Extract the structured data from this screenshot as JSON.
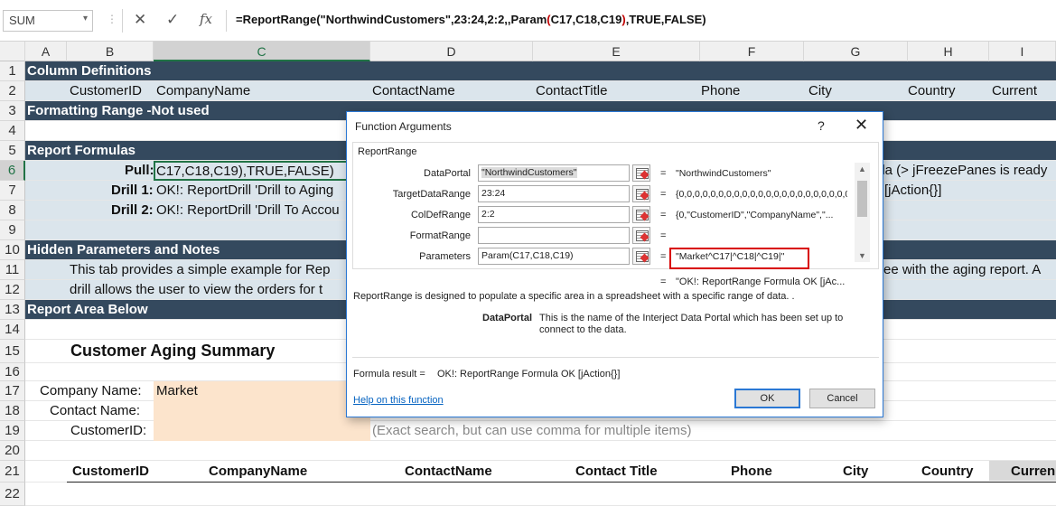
{
  "formula_bar": {
    "name_box": "SUM",
    "cancel_icon": "✕",
    "enter_icon": "✓",
    "fx_icon": "fx",
    "formula_a": "=ReportRange(\"NorthwindCustomers\",23:24,2:2,,Param",
    "formula_b": "(",
    "formula_c": "C17,C18,C19",
    "formula_d": ")",
    "formula_e": ",TRUE,FALSE)"
  },
  "columns": [
    "A",
    "B",
    "C",
    "D",
    "E",
    "F",
    "G",
    "H",
    "I"
  ],
  "rows": [
    "1",
    "2",
    "3",
    "4",
    "5",
    "6",
    "7",
    "8",
    "9",
    "10",
    "11",
    "12",
    "13",
    "14",
    "15",
    "16",
    "17",
    "18",
    "19",
    "20",
    "21",
    "22"
  ],
  "sheet": {
    "col_definitions": "Column Definitions",
    "col_defs": [
      "CustomerID",
      "CompanyName",
      "ContactName",
      "ContactTitle",
      "Phone",
      "City",
      "Country",
      "Current"
    ],
    "formatting_range": "Formatting Range -Not used",
    "report_formulas": "Report Formulas",
    "pull_label": "Pull:",
    "pull_value": "C17,C18,C19),TRUE,FALSE)",
    "drill1_label": "Drill 1:",
    "drill1_value": "OK!: ReportDrill 'Drill to Aging",
    "drill2_label": "Drill 2:",
    "drill2_value": "OK!: ReportDrill 'Drill To Accou",
    "right_row6": "ula (> jFreezePanes is ready",
    "right_row7": "[jAction{}]",
    "hidden_params": "Hidden Parameters and Notes",
    "note11": "This tab provides a simple example for Rep",
    "note11_right": "ee with the aging report. A",
    "note12": "drill allows the user to view the orders for t",
    "report_area": "Report Area Below",
    "summary_title": "Customer Aging Summary",
    "company_label": "Company Name:",
    "company_value": "Market",
    "contact_label": "Contact Name:",
    "customerid_label": "CustomerID:",
    "hint19": "(Exact search, but can use comma for multiple items)",
    "report_headers": [
      "CustomerID",
      "CompanyName",
      "ContactName",
      "Contact Title",
      "Phone",
      "City",
      "Country",
      "Curren"
    ]
  },
  "dialog": {
    "title": "Function Arguments",
    "help_q": "?",
    "close": "✕",
    "function_name": "ReportRange",
    "args": [
      {
        "label": "DataPortal",
        "value": "\"NorthwindCustomers\"",
        "result": "\"NorthwindCustomers\""
      },
      {
        "label": "TargetDataRange",
        "value": "23:24",
        "result": "{0,0,0,0,0,0,0,0,0,0,0,0,0,0,0,0,0,0,0,0,0,0..."
      },
      {
        "label": "ColDefRange",
        "value": "2:2",
        "result": "{0,\"CustomerID\",\"CompanyName\",\"..."
      },
      {
        "label": "FormatRange",
        "value": "",
        "result": ""
      },
      {
        "label": "Parameters",
        "value": "Param(C17,C18,C19)",
        "result": "\"Market^C17|^C18|^C19|\""
      }
    ],
    "eq": "=",
    "overall_result": "\"OK!: ReportRange Formula OK [jAc...",
    "description": "ReportRange is designed to populate a specific area in a spreadsheet with a specific range of data. .",
    "arg_name": "DataPortal",
    "arg_desc_1": "This is the name of the Interject Data Portal which has been set up to",
    "arg_desc_2": "connect to the data.",
    "formula_result_label": "Formula result =",
    "formula_result_value": "OK!: ReportRange Formula OK [jAction{}]",
    "help_link": "Help on this function",
    "ok": "OK",
    "cancel": "Cancel"
  },
  "colors": {
    "dark_band": "#34495e",
    "light_band": "#dbe5ec",
    "peach": "#fce4cc",
    "excel_green": "#217346",
    "highlight_red": "#d80000"
  }
}
